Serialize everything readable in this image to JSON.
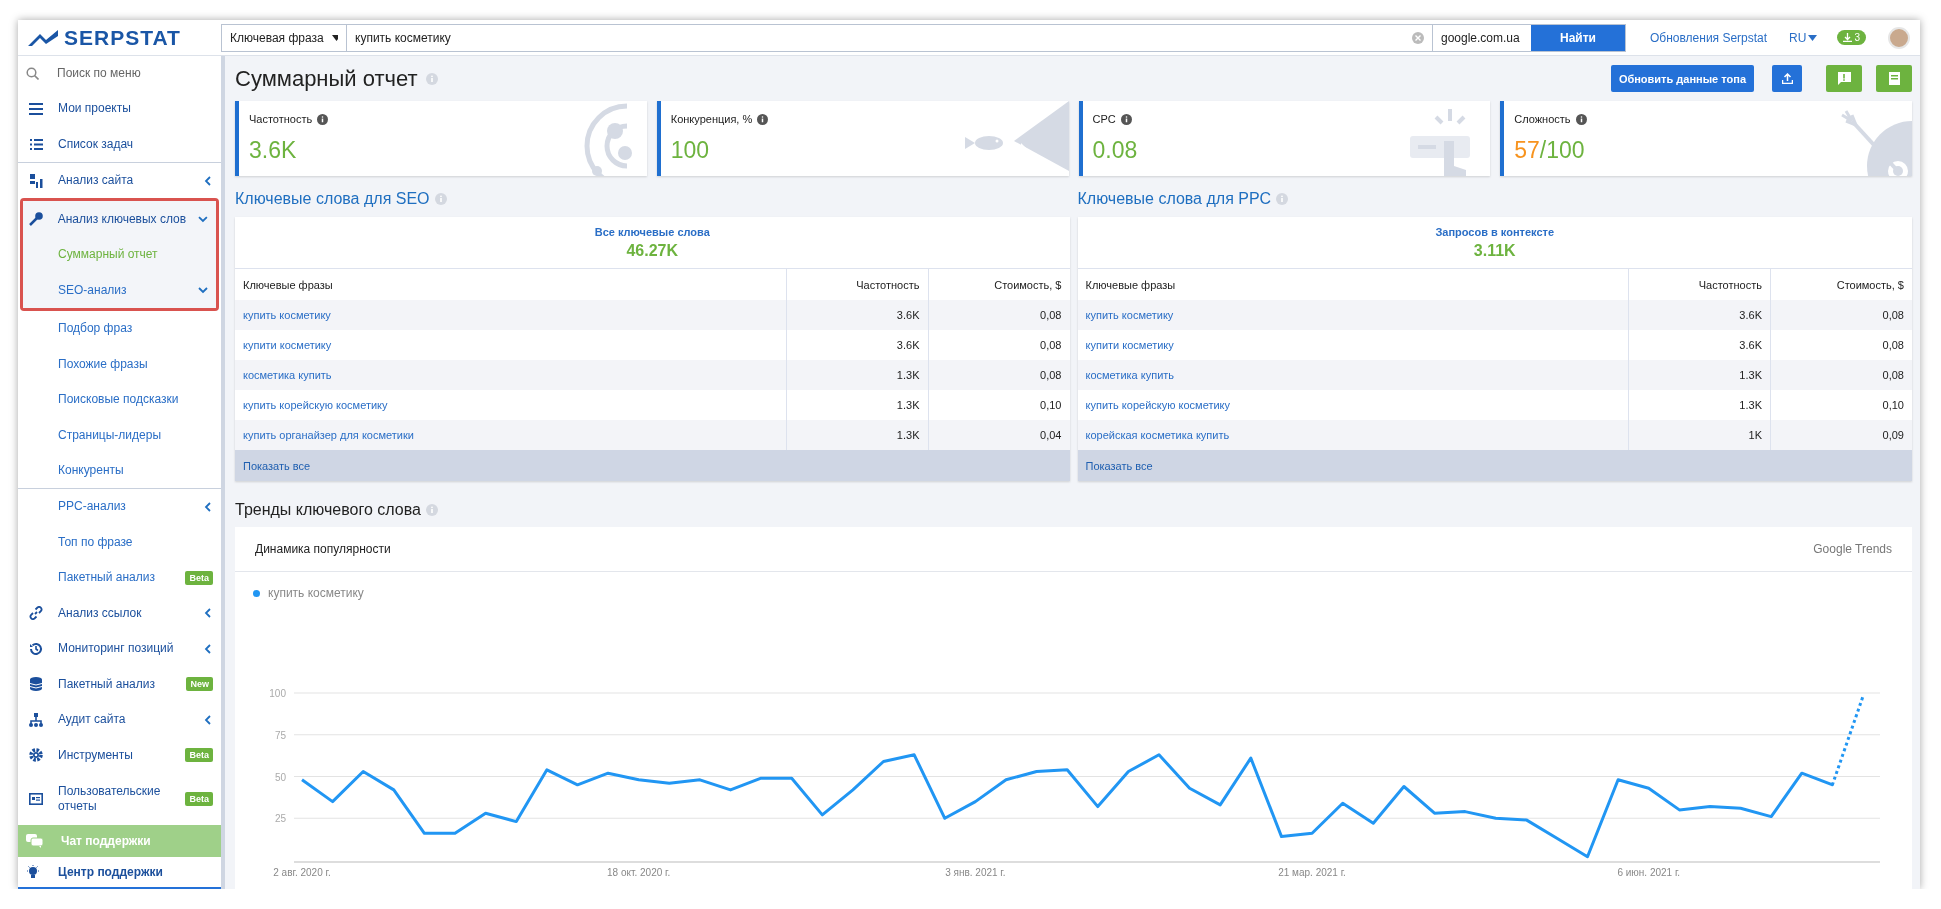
{
  "topbar": {
    "logo": "SERPSTAT",
    "search_type": "Ключевая фраза",
    "query": "купить косметику",
    "region": "google.com.ua",
    "search_button": "Найти",
    "updates_link": "Обновления Serpstat",
    "language": "RU",
    "downloads_count": "3"
  },
  "sidebar": {
    "search_placeholder": "Поиск по меню",
    "groups": [
      [
        {
          "label": "Мои проекты",
          "selected": false
        },
        {
          "label": "Список задач",
          "selected": false
        }
      ],
      [
        {
          "label": "Анализ сайта",
          "selected": false,
          "expanded": false
        },
        {
          "label": "Анализ ключевых слов",
          "selected": false,
          "expanded": true,
          "highlighted": true,
          "children": [
            {
              "label": "Суммарный отчет",
              "selected": true,
              "highlighted": true
            },
            {
              "label": "SEO-анализ",
              "selected": false,
              "expanded": true,
              "highlighted": true,
              "children": [
                {
                  "label": "Подбор фраз",
                  "selected": false
                },
                {
                  "label": "Похожие фразы",
                  "selected": false
                },
                {
                  "label": "Поисковые подсказки",
                  "selected": false
                },
                {
                  "label": "Страницы-лидеры",
                  "selected": false
                },
                {
                  "label": "Конкуренты",
                  "selected": false
                }
              ]
            },
            {
              "label": "PPC-анализ",
              "selected": false,
              "expanded": false
            },
            {
              "label": "Топ по фразе",
              "selected": false
            },
            {
              "label": "Пакетный анализ",
              "selected": false,
              "badge": "Beta"
            }
          ]
        }
      ],
      [
        {
          "label": "Анализ ссылок",
          "selected": false,
          "expanded": false
        },
        {
          "label": "Мониторинг позиций",
          "selected": false,
          "expanded": false
        },
        {
          "label": "Пакетный анализ",
          "selected": false,
          "badge": "New"
        },
        {
          "label": "Аудит сайта",
          "selected": false,
          "expanded": false
        },
        {
          "label": "Инструменты",
          "selected": false,
          "badge": "Beta"
        },
        {
          "label": "Пользовательские отчеты",
          "selected": false,
          "badge": "Beta"
        }
      ]
    ],
    "footer": [
      {
        "label": "Чат поддержки",
        "kind": "chat"
      },
      {
        "label": "Центр поддержки",
        "kind": "help"
      }
    ]
  },
  "page": {
    "title": "Суммарный отчет",
    "refresh_button": "Обновить данные топа"
  },
  "cards": [
    {
      "label": "Частотность",
      "value": "3.6K",
      "color": "#6db33f"
    },
    {
      "label": "Конкуренция, %",
      "value": "100",
      "color": "#6db33f"
    },
    {
      "label": "CPC",
      "value": "0.08",
      "color": "#6db33f"
    },
    {
      "label": "Сложность",
      "value": "57",
      "suffix": "/100",
      "color": "#f7931e"
    }
  ],
  "tables": [
    {
      "title": "Ключевые слова для SEO",
      "summary_label": "Все ключевые слова",
      "summary_value": "46.27K",
      "columns": [
        "Ключевые фразы",
        "Частотность",
        "Стоимость, $"
      ],
      "rows": [
        [
          "купить косметику",
          "3.6K",
          "0,08"
        ],
        [
          "купити косметику",
          "3.6K",
          "0,08"
        ],
        [
          "косметика купить",
          "1.3K",
          "0,08"
        ],
        [
          "купить корейскую косметику",
          "1.3K",
          "0,10"
        ],
        [
          "купить органайзер для косметики",
          "1.3K",
          "0,04"
        ]
      ],
      "show_all": "Показать все"
    },
    {
      "title": "Ключевые слова для PPC",
      "summary_label": "Запросов в контексте",
      "summary_value": "3.11K",
      "columns": [
        "Ключевые фразы",
        "Частотность",
        "Стоимость, $"
      ],
      "rows": [
        [
          "купить косметику",
          "3.6K",
          "0,08"
        ],
        [
          "купити косметику",
          "3.6K",
          "0,08"
        ],
        [
          "косметика купить",
          "1.3K",
          "0,08"
        ],
        [
          "купить корейскую косметику",
          "1.3K",
          "0,10"
        ],
        [
          "корейская косметика купить",
          "1K",
          "0,09"
        ]
      ],
      "show_all": "Показать все"
    }
  ],
  "trends": {
    "title": "Тренды ключевого слова",
    "card_title": "Динамика популярности",
    "source": "Google Trends",
    "chart_data": {
      "type": "line",
      "ylim": [
        0,
        100
      ],
      "yticks": [
        25,
        50,
        75,
        100
      ],
      "grid": true,
      "categories": [
        "2 авг. 2020 г.",
        null,
        null,
        null,
        null,
        null,
        null,
        null,
        null,
        null,
        null,
        "18 окт. 2020 г.",
        null,
        null,
        null,
        null,
        null,
        null,
        null,
        null,
        null,
        null,
        "3 янв. 2021 г.",
        null,
        null,
        null,
        null,
        null,
        null,
        null,
        null,
        null,
        null,
        "21 мар. 2021 г.",
        null,
        null,
        null,
        null,
        null,
        null,
        null,
        null,
        null,
        null,
        "6 июн. 2021 г.",
        null,
        null,
        null,
        null,
        null,
        null,
        null
      ],
      "series": [
        {
          "name": "купить косметику",
          "color": "#2196f3",
          "line_style": "solid-dotted-end",
          "values": [
            48,
            35,
            53,
            42,
            16,
            16,
            28,
            23,
            54,
            45,
            52,
            48,
            46,
            48,
            42,
            49,
            49,
            27,
            42,
            59,
            63,
            25,
            35,
            48,
            53,
            54,
            32,
            53,
            63,
            43,
            33,
            61,
            14,
            16,
            34,
            22,
            44,
            28,
            29,
            25,
            24,
            13,
            2,
            48,
            43,
            30,
            32,
            31,
            26,
            52,
            45,
            98
          ]
        }
      ]
    }
  }
}
